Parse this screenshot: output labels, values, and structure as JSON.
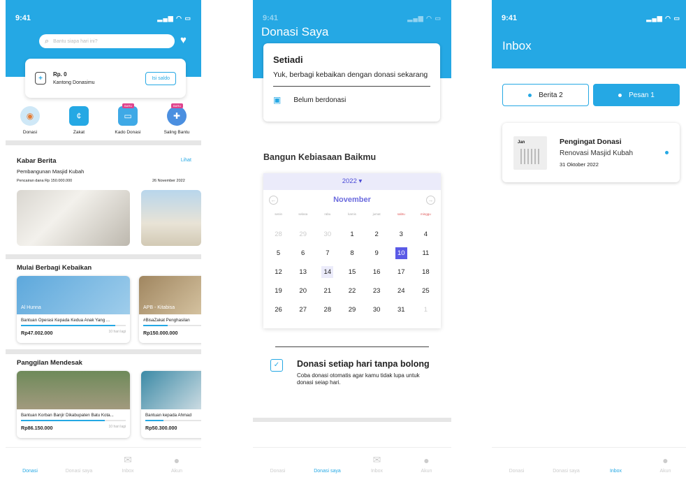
{
  "screen1": {
    "status": {
      "time": "9:41"
    },
    "search": {
      "placeholder": "Bantu siapa hari ini?"
    },
    "wallet": {
      "amount": "Rp. 0",
      "label": "Kantong Donasimu",
      "button": "Isi saldo"
    },
    "menu": [
      {
        "label": "Donasi",
        "icon": "donation-icon"
      },
      {
        "label": "Zakat",
        "icon": "zakat-icon"
      },
      {
        "label": "Kado Donasi",
        "icon": "gift-icon",
        "badge": "BARU"
      },
      {
        "label": "Saling Bantu",
        "icon": "help-icon",
        "badge": "BARU"
      }
    ],
    "news": {
      "title": "Kabar Berita",
      "link": "Lihat",
      "headline": "Pembangunan Masjid Kubah",
      "subline": "Pencairan dana Rp 150.000.000",
      "date": "26 November 2022"
    },
    "share": {
      "title": "Mulai Berbagi Kebaikan",
      "cards": [
        {
          "tag": "Al Hunna",
          "title": "Bantuan Operasi Kepada Kedua Anak Yang ...",
          "amount": "Rp47.002.000",
          "left": "10 hari lagi",
          "progress": 0.9
        },
        {
          "tag": "APB - Kitabisa",
          "title": "#BisaZakat Penghasilan",
          "amount": "Rp150.000.000",
          "left": "",
          "progress": 0.4
        }
      ]
    },
    "urgent": {
      "title": "Panggilan Mendesak",
      "cards": [
        {
          "title": "Bantuan Korban Banjir Dikabupaten Batu Kota...",
          "amount": "Rp86.150.000",
          "left": "10 hari lagi",
          "progress": 0.8
        },
        {
          "title": "Bantuan kepada Ahmad",
          "amount": "Rp50.300.000",
          "left": "",
          "progress": 0.3
        }
      ]
    },
    "nav": [
      "Donasi",
      "Donasi saya",
      "Inbox",
      "Akun"
    ]
  },
  "screen2": {
    "status": {
      "time": "9:41"
    },
    "title": "Donasi Saya",
    "card": {
      "name": "Setiadi",
      "subtitle": "Yuk, berbagi kebaikan dengan donasi sekarang",
      "status": "Belum berdonasi"
    },
    "habit_title": "Bangun Kebiasaan Baikmu",
    "calendar": {
      "year": "2022",
      "month": "November",
      "weekdays": [
        "senin",
        "selasa",
        "rabu",
        "kamis",
        "jumat",
        "sabtu",
        "minggu"
      ],
      "weeks": [
        [
          "28",
          "29",
          "30",
          "1",
          "2",
          "3",
          "4"
        ],
        [
          "5",
          "6",
          "7",
          "8",
          "9",
          "10",
          "11"
        ],
        [
          "12",
          "13",
          "14",
          "15",
          "16",
          "17",
          "18"
        ],
        [
          "19",
          "20",
          "21",
          "22",
          "23",
          "24",
          "25"
        ],
        [
          "26",
          "27",
          "28",
          "29",
          "30",
          "31",
          "1"
        ]
      ],
      "selected": "10",
      "today": "14"
    },
    "auto": {
      "title": "Donasi setiap hari tanpa bolong",
      "desc": "Coba donasi otomatis agar kamu tidak lupa untuk donasi seiap hari."
    },
    "nav": [
      "Donasi",
      "Donasi saya",
      "Inbox",
      "Akun"
    ]
  },
  "screen3": {
    "status": {
      "time": "9:41"
    },
    "title": "Inbox",
    "tabs": [
      "Berita 2",
      "Pesan 1"
    ],
    "message": {
      "title": "Pengingat Donasi",
      "subtitle": "Renovasi Masjid Kubah",
      "date": "31 Oktober 2022",
      "icon_label": "Jan"
    },
    "nav": [
      "Donasi",
      "Donasi saya",
      "Inbox",
      "Akun"
    ]
  },
  "colors": {
    "accent": "#25A8E4",
    "calendar_accent": "#5A5AE6"
  }
}
